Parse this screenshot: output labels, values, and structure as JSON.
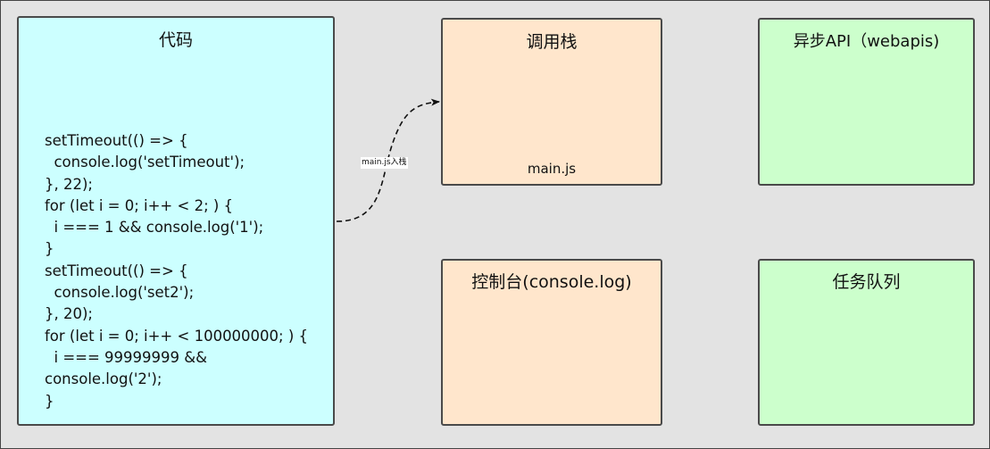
{
  "code_panel": {
    "title": "代码",
    "lines": [
      "setTimeout(() => {",
      "  console.log('setTimeout');",
      "}, 22);",
      "for (let i = 0; i++ < 2; ) {",
      "  i === 1 && console.log('1');",
      "}",
      "setTimeout(() => {",
      "  console.log('set2');",
      "}, 20);",
      "for (let i = 0; i++ < 100000000; ) {",
      "  i === 99999999 &&",
      "console.log('2');",
      "}"
    ]
  },
  "call_stack": {
    "title": "调用栈",
    "frames": [
      "main.js"
    ]
  },
  "web_apis": {
    "title": "异步API（webapis)"
  },
  "console_panel": {
    "title": "控制台(console.log)"
  },
  "task_queue": {
    "title": "任务队列"
  },
  "edge": {
    "label": "main.js入栈"
  },
  "colors": {
    "code_fill": "#ccffff",
    "stack_fill": "#ffe6cc",
    "api_fill": "#ccffcc",
    "background": "#e3e3e3",
    "stroke": "#4a4a4a"
  }
}
